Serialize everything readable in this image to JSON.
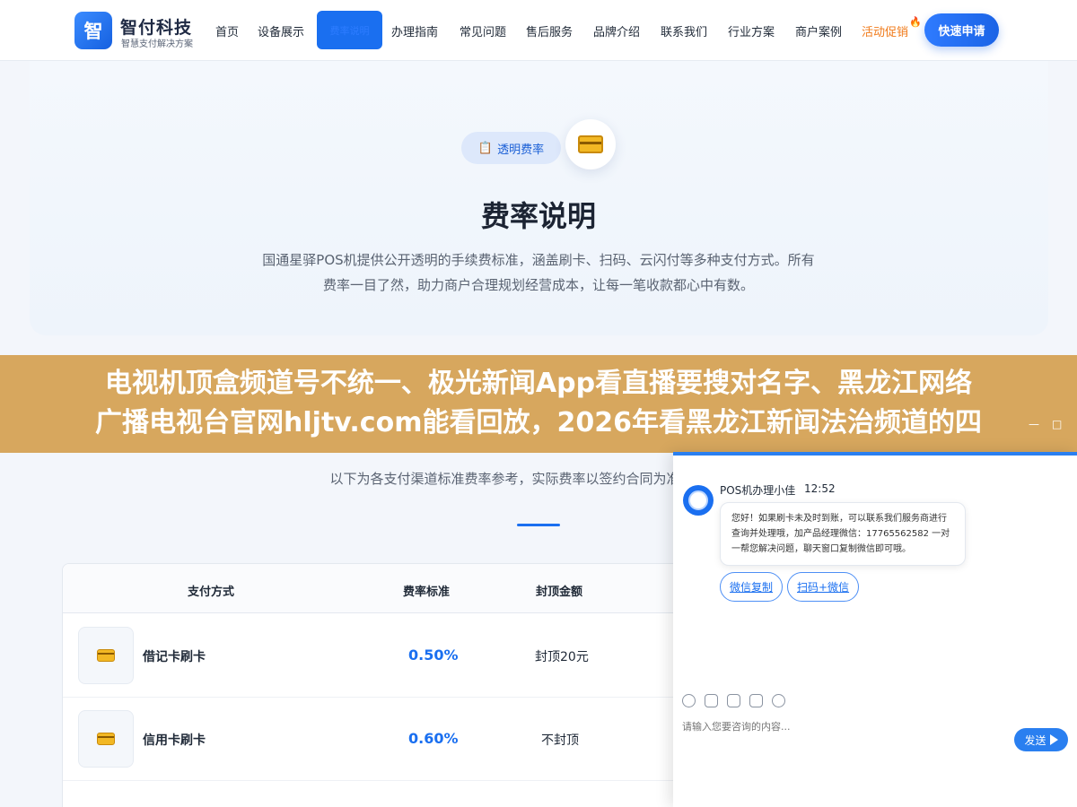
{
  "nav": {
    "logo_mark": "智",
    "logo_name": "智付科技",
    "logo_sub": "智慧支付解决方案",
    "items": [
      "首页",
      "设备展示",
      "费率说明",
      "办理指南",
      "常见问题",
      "售后服务",
      "品牌介绍",
      "联系我们",
      "行业方案",
      "商户案例",
      "活动促销"
    ],
    "cta": "快速申请"
  },
  "hero": {
    "badge": "透明费率",
    "title": "费率说明",
    "desc": "国通星驿POS机提供公开透明的手续费标准，涵盖刷卡、扫码、云闪付等多种支付方式。所有费率一目了然，助力商户合理规划经营成本，让每一笔收款都心中有数。"
  },
  "banner": {
    "line1": "电视机顶盒频道号不统一、极光新闻App看直播要搜对名字、黑龙江网络",
    "line2": "广播电视台官网hljtv.com能看回放，2026年看黑龙江新闻法治频道的四",
    "min": "—",
    "max": "□"
  },
  "section": {
    "desc": "以下为各支付渠道标准费率参考，实际费率以签约合同为准，存在差异"
  },
  "table": {
    "headers": [
      "支付方式",
      "费率标准",
      "封顶金额"
    ],
    "rows": [
      {
        "name": "借记卡刷卡",
        "rate": "0.50%",
        "cap": "封顶20元"
      },
      {
        "name": "信用卡刷卡",
        "rate": "0.60%",
        "cap": "不封顶"
      }
    ]
  },
  "chat": {
    "agent": "POS机办理小佳",
    "time": "12:52",
    "message": "您好！如果刷卡未及时到账，可以联系我们服务商进行查询并处理哦，加产品经理微信：17765562582 一对一帮您解决问题，聊天窗口复制微信即可哦。",
    "chips": [
      "微信复制",
      "扫码+微信"
    ],
    "input_placeholder": "请输入您要咨询的内容...",
    "send": "发送"
  }
}
